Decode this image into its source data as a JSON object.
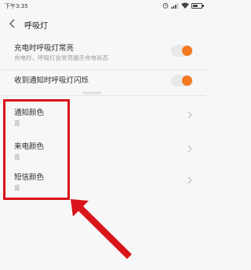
{
  "status_bar": {
    "time": "下午3:35",
    "icons": [
      "alarm-icon",
      "signal-icon",
      "wifi-icon",
      "battery-icon"
    ],
    "battery_level": 0.55
  },
  "header": {
    "title": "呼吸灯",
    "back_icon": "chevron-left-icon"
  },
  "settings": [
    {
      "label": "充电时呼吸灯常亮",
      "sub": "充电时，呼吸灯会常亮提示充电状态",
      "control": "toggle",
      "on": true
    },
    {
      "label": "收到通知时呼吸灯闪烁",
      "sub": "",
      "control": "toggle",
      "on": true
    },
    {
      "label": "通知颜色",
      "sub": "蓝",
      "control": "chevron"
    },
    {
      "label": "来电颜色",
      "sub": "蓝",
      "control": "chevron"
    },
    {
      "label": "短信颜色",
      "sub": "蓝",
      "control": "chevron"
    }
  ],
  "colors": {
    "accent": "#f47920",
    "highlight": "#d9141b"
  }
}
